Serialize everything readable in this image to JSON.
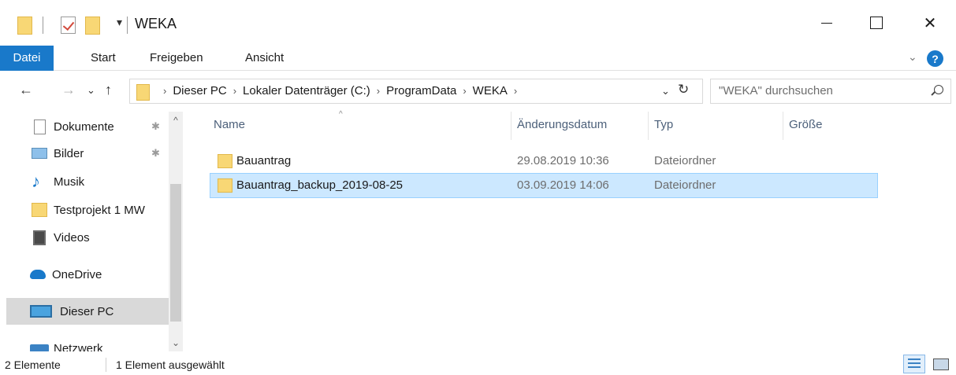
{
  "window": {
    "title": "WEKA",
    "qa_dropdown_glyph": "▾",
    "controls": {
      "minimize": "",
      "maximize": "",
      "close": "✕"
    }
  },
  "ribbon": {
    "tabs": [
      {
        "label": "Datei",
        "active": true
      },
      {
        "label": "Start"
      },
      {
        "label": "Freigeben"
      },
      {
        "label": "Ansicht"
      }
    ],
    "expand_glyph": "⌄",
    "help_glyph": "?"
  },
  "nav": {
    "back": "←",
    "forward": "→",
    "recent": "⌄",
    "up": "↑"
  },
  "address": {
    "crumbs": [
      "Dieser PC",
      "Lokaler Datenträger (C:)",
      "ProgramData",
      "WEKA"
    ],
    "separator": "›",
    "dropdown_glyph": "⌄",
    "refresh_glyph": "↻"
  },
  "search": {
    "placeholder": "\"WEKA\" durchsuchen"
  },
  "navpane": {
    "items": [
      {
        "label": "Dokumente",
        "icon": "document-icon",
        "pinned": true
      },
      {
        "label": "Bilder",
        "icon": "pictures-icon",
        "pinned": true
      },
      {
        "label": "Musik",
        "icon": "music-icon"
      },
      {
        "label": "Testprojekt 1 MW",
        "icon": "folder-icon"
      },
      {
        "label": "Videos",
        "icon": "videos-icon"
      },
      {
        "label": "OneDrive",
        "icon": "onedrive-icon"
      },
      {
        "label": "Dieser PC",
        "icon": "this-pc-icon",
        "selected": true
      },
      {
        "label": "Netzwerk",
        "icon": "network-icon"
      }
    ],
    "pin_glyph": "📌",
    "scroll_up": "^",
    "scroll_down": "⌄"
  },
  "list": {
    "columns": [
      "Name",
      "Änderungsdatum",
      "Typ",
      "Größe"
    ],
    "sort_glyph": "^",
    "rows": [
      {
        "name": "Bauantrag",
        "date": "29.08.2019 10:36",
        "type": "Dateiordner",
        "size": "",
        "selected": false
      },
      {
        "name": "Bauantrag_backup_2019-08-25",
        "date": "03.09.2019 14:06",
        "type": "Dateiordner",
        "size": "",
        "selected": true
      }
    ]
  },
  "status": {
    "count": "2 Elemente",
    "selection": "1 Element ausgewählt"
  },
  "colors": {
    "accent": "#1979ca",
    "selection_bg": "#cce8ff",
    "selection_border": "#99d1ff",
    "folder": "#f8d775"
  }
}
